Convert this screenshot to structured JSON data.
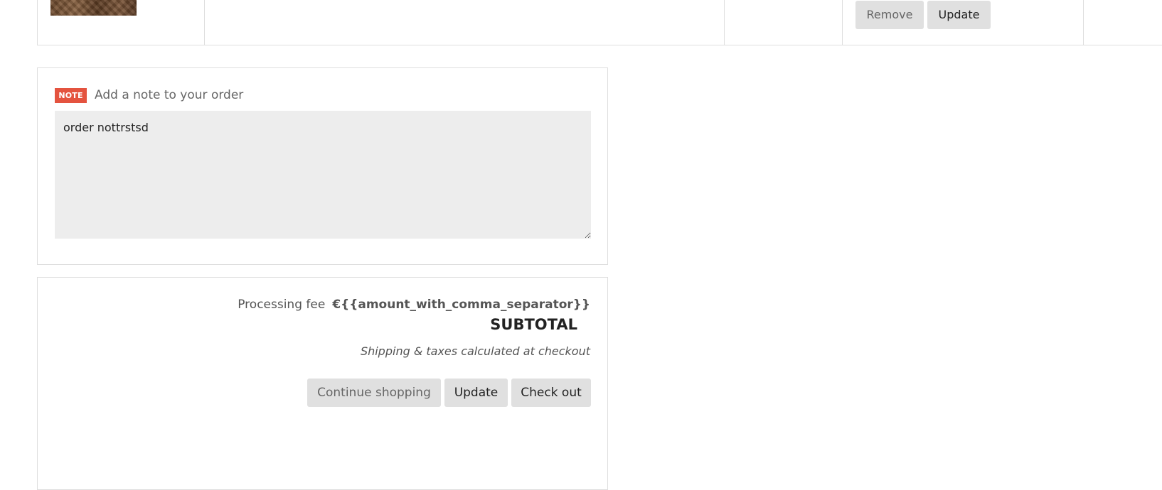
{
  "cart_row": {
    "remove_label": "Remove",
    "update_label": "Update"
  },
  "note": {
    "badge": "NOTE",
    "label": "Add a note to your order",
    "value": "order nottrstsd"
  },
  "totals": {
    "fee_label": "Processing fee",
    "fee_value": "€{{amount_with_comma_separator}}",
    "subtotal_label": "SUBTOTAL",
    "shipping_note": "Shipping & taxes calculated at checkout",
    "continue_label": "Continue shopping",
    "update_label": "Update",
    "checkout_label": "Check out"
  }
}
